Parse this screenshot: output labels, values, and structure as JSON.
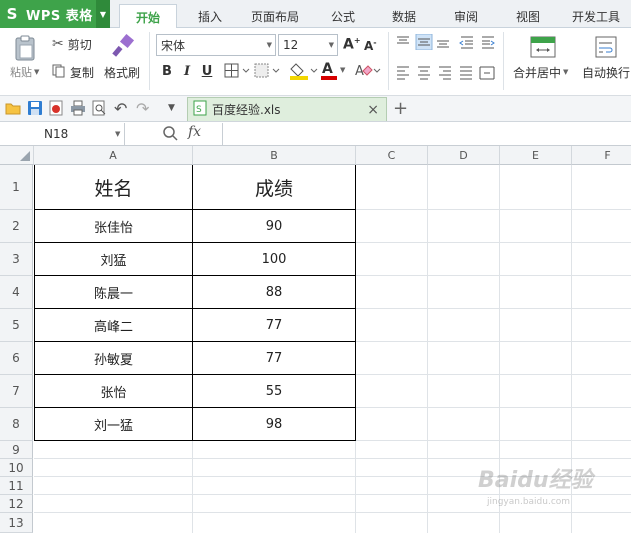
{
  "app": {
    "title": "WPS 表格",
    "logo": "S"
  },
  "ribbon_tabs": [
    "开始",
    "插入",
    "页面布局",
    "公式",
    "数据",
    "审阅",
    "视图",
    "开发工具"
  ],
  "clipboard": {
    "paste": "粘贴",
    "cut": "剪切",
    "copy": "复制",
    "format_painter": "格式刷"
  },
  "font": {
    "name": "宋体",
    "size": "12",
    "bold": "B",
    "italic": "I",
    "underline": "U",
    "font_color_glyph": "A"
  },
  "align": {
    "merge_center": "合并居中",
    "wrap": "自动换行"
  },
  "document_tab": {
    "name": "百度经验.xls",
    "close": "×",
    "new": "+"
  },
  "formula_bar": {
    "cell_ref": "N18",
    "fx": "fx"
  },
  "columns": [
    "A",
    "B",
    "C",
    "D",
    "E",
    "F"
  ],
  "rows": [
    "1",
    "2",
    "3",
    "4",
    "5",
    "6",
    "7",
    "8",
    "9",
    "10",
    "11",
    "12",
    "13"
  ],
  "table": {
    "headers": [
      "姓名",
      "成绩"
    ],
    "rows": [
      [
        "张佳怡",
        "90"
      ],
      [
        "刘猛",
        "100"
      ],
      [
        "陈晨一",
        "88"
      ],
      [
        "高峰二",
        "77"
      ],
      [
        "孙敏夏",
        "77"
      ],
      [
        "张怡",
        "55"
      ],
      [
        "刘一猛",
        "98"
      ]
    ]
  },
  "watermark": {
    "main": "Baidu经验",
    "sub": "jingyan.baidu.com"
  },
  "colors": {
    "brand_green": "#3ea34a",
    "grid_line": "#dfe3e7",
    "header_bg": "#f2f4f6"
  }
}
